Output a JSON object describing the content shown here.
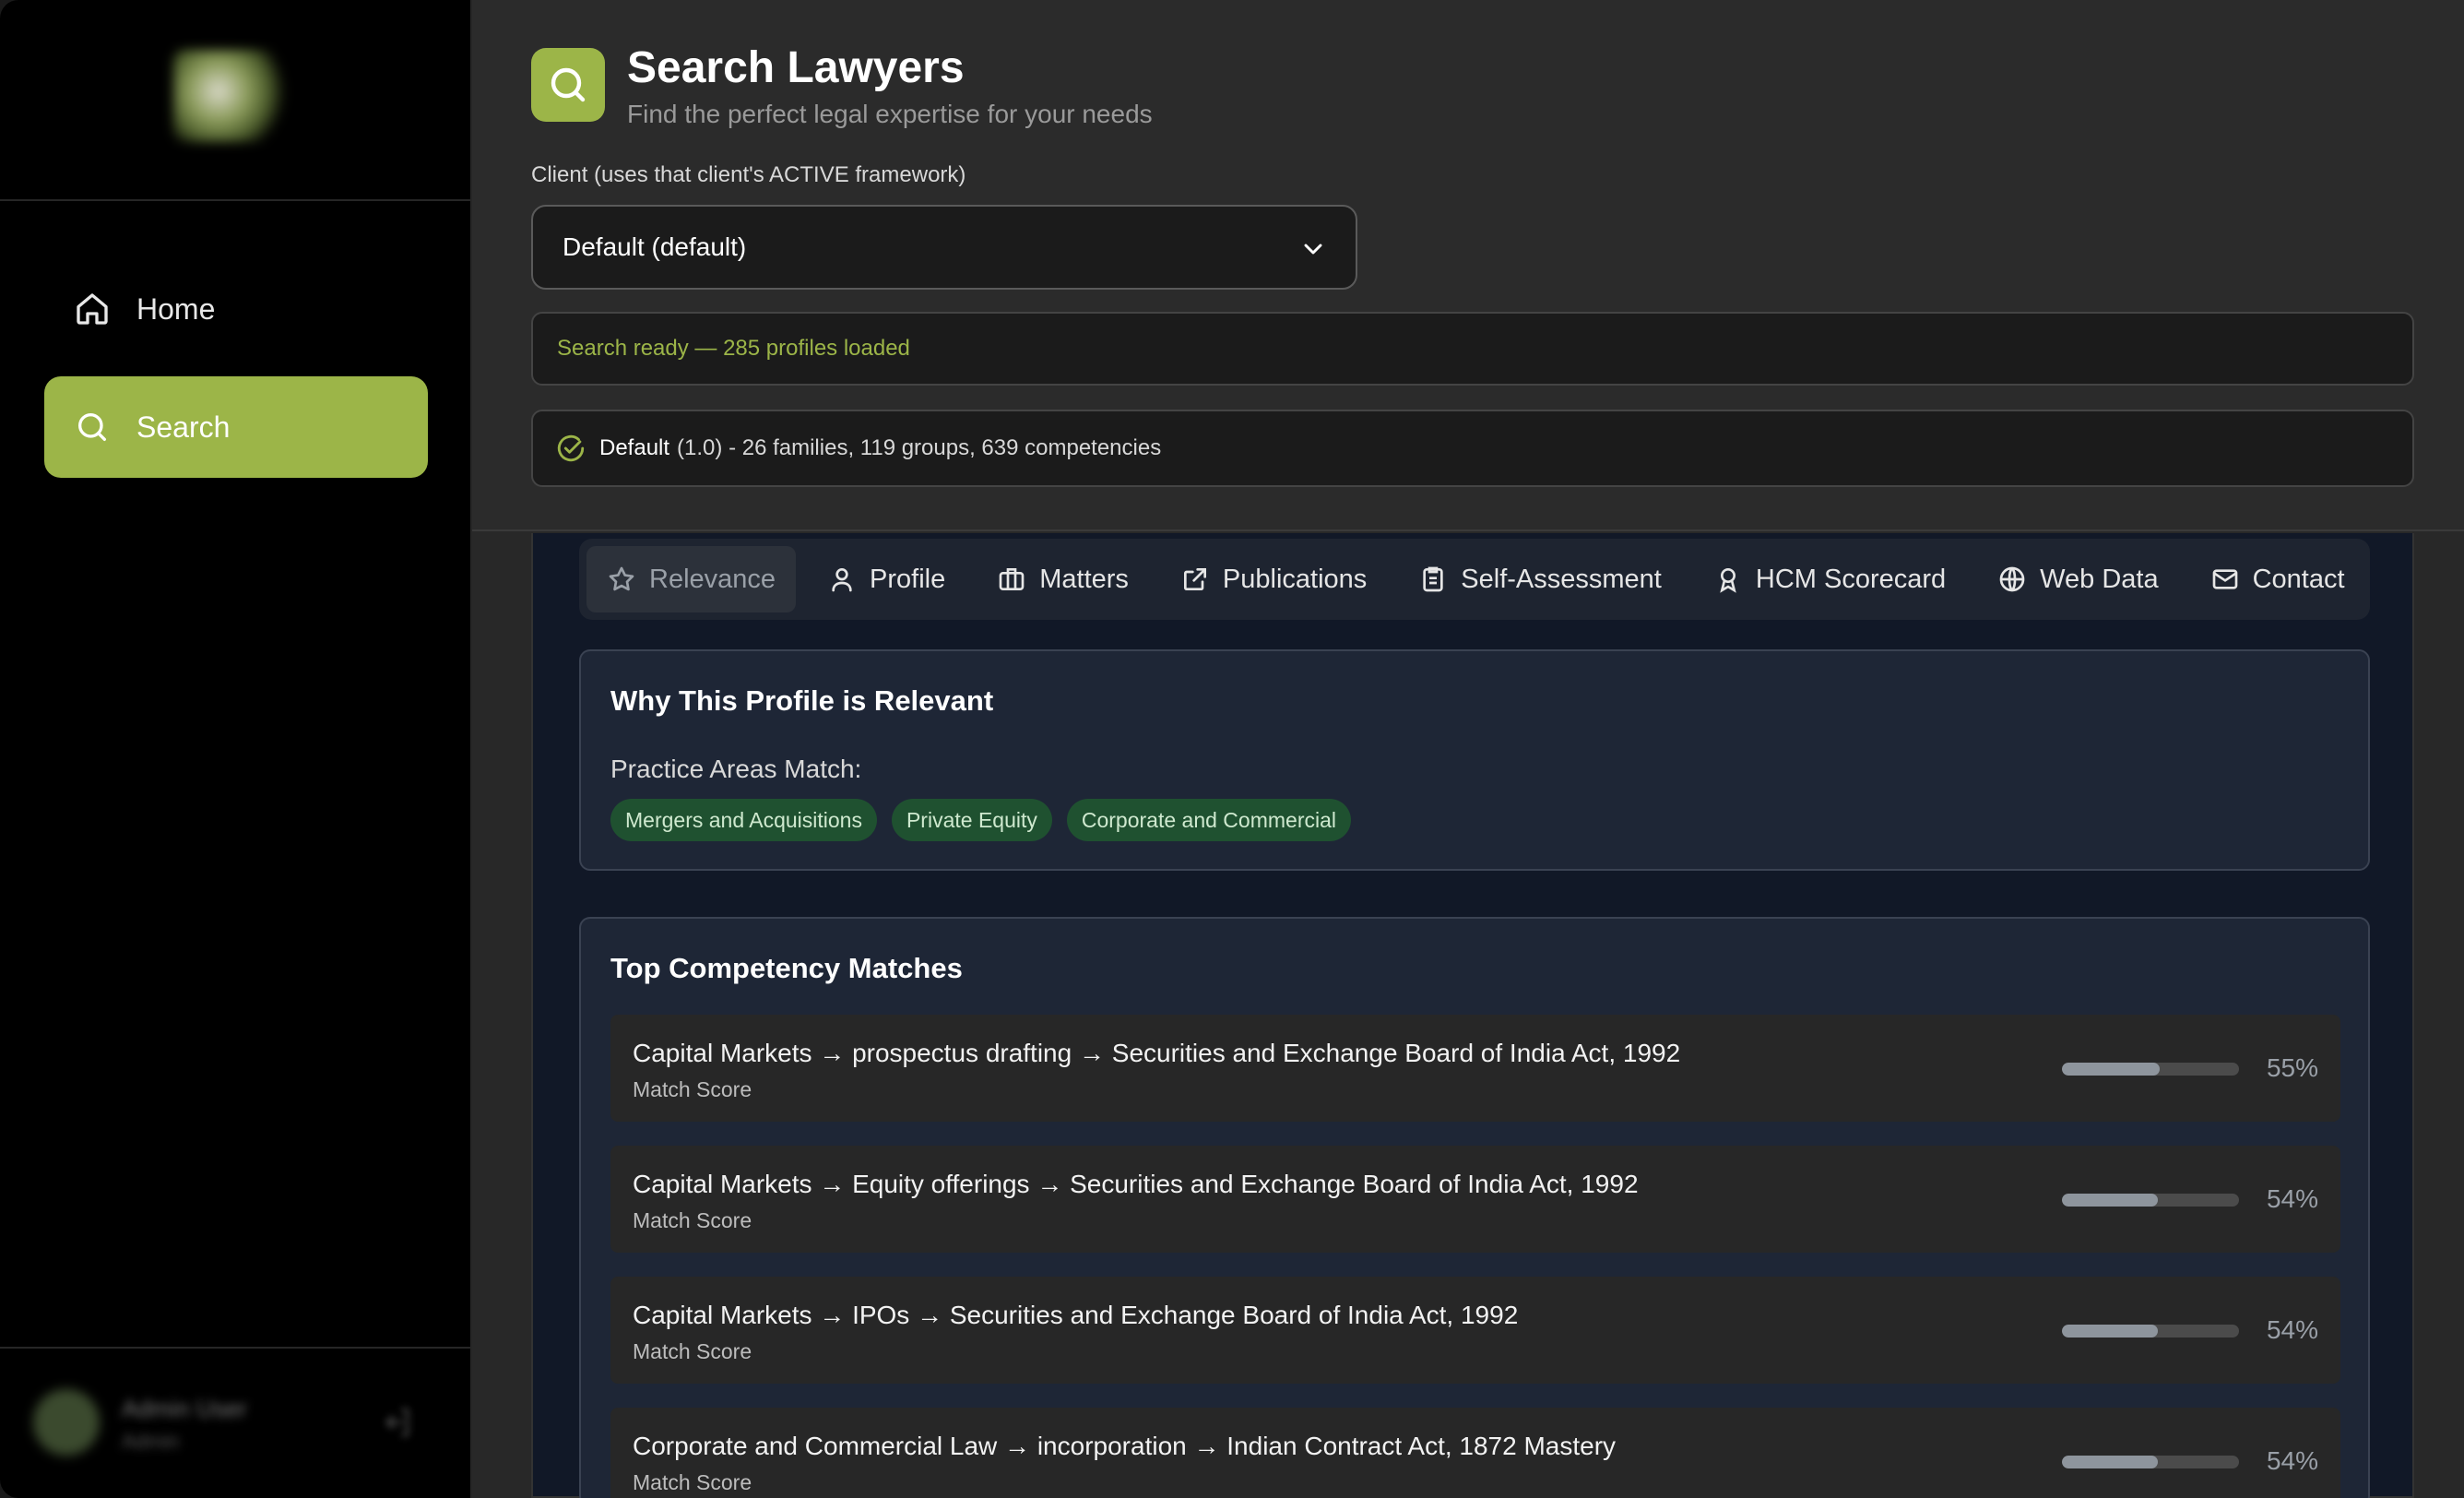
{
  "sidebar": {
    "nav": [
      {
        "label": "Home",
        "icon": "home-icon",
        "active": false
      },
      {
        "label": "Search",
        "icon": "search-icon",
        "active": true
      }
    ],
    "user": {
      "name": "Admin User",
      "role": "Admin"
    }
  },
  "header": {
    "title": "Search Lawyers",
    "subtitle": "Find the perfect legal expertise for your needs",
    "client_label": "Client (uses that client's ACTIVE framework)",
    "client_value": "Default (default)",
    "status": "Search ready — 285 profiles loaded",
    "framework_name": "Default",
    "framework_details": "(1.0) - 26 families, 119 groups, 639 competencies"
  },
  "tabs": [
    {
      "label": "Relevance",
      "icon": "star-icon",
      "active": true
    },
    {
      "label": "Profile",
      "icon": "user-icon",
      "active": false
    },
    {
      "label": "Matters",
      "icon": "briefcase-icon",
      "active": false
    },
    {
      "label": "Publications",
      "icon": "external-link-icon",
      "active": false
    },
    {
      "label": "Self-Assessment",
      "icon": "clipboard-icon",
      "active": false
    },
    {
      "label": "HCM Scorecard",
      "icon": "award-icon",
      "active": false
    },
    {
      "label": "Web Data",
      "icon": "globe-icon",
      "active": false
    },
    {
      "label": "Contact",
      "icon": "mail-icon",
      "active": false
    }
  ],
  "relevance": {
    "title": "Why This Profile is Relevant",
    "practice_label": "Practice Areas Match:",
    "practice_areas": [
      "Mergers and Acquisitions",
      "Private Equity",
      "Corporate and Commercial"
    ]
  },
  "competency": {
    "title": "Top Competency Matches",
    "sub_label": "Match Score",
    "items": [
      {
        "name": "Capital Markets → prospectus drafting → Securities and Exchange Board of India Act, 1992",
        "score": 55,
        "score_label": "55%"
      },
      {
        "name": "Capital Markets → Equity offerings → Securities and Exchange Board of India Act, 1992",
        "score": 54,
        "score_label": "54%"
      },
      {
        "name": "Capital Markets → IPOs → Securities and Exchange Board of India Act, 1992",
        "score": 54,
        "score_label": "54%"
      },
      {
        "name": "Corporate and Commercial Law → incorporation → Indian Contract Act, 1872 Mastery",
        "score": 54,
        "score_label": "54%"
      }
    ]
  },
  "colors": {
    "accent": "#9cb548",
    "pill_bg": "#1f5130",
    "content_bg": "#111827"
  }
}
